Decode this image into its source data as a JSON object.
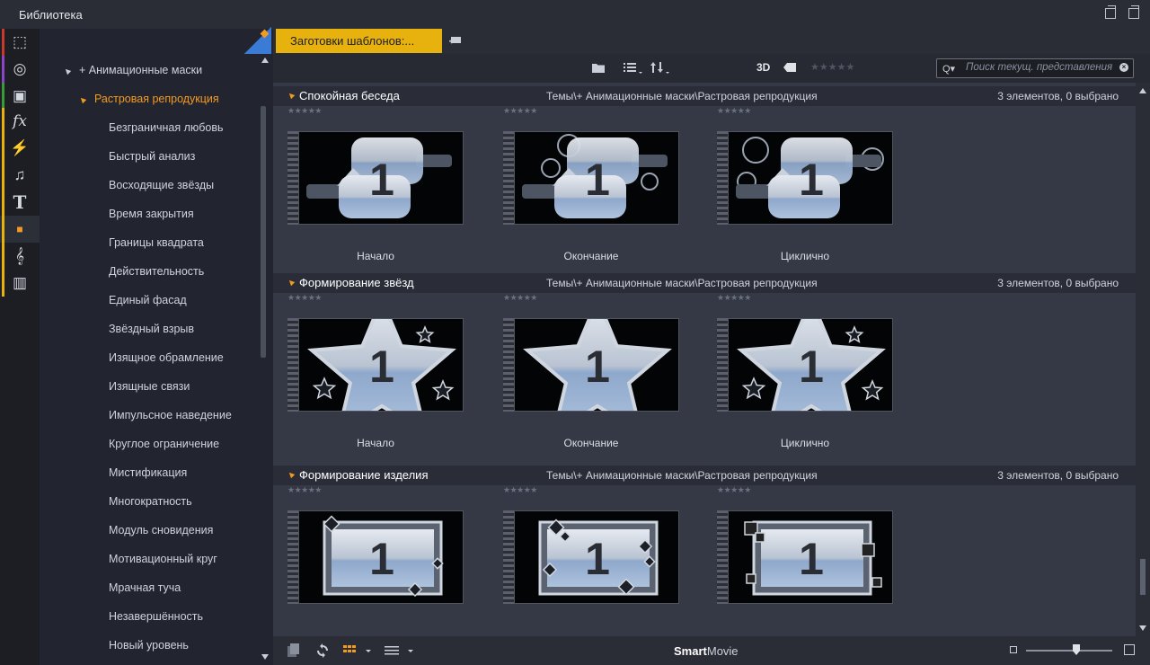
{
  "window": {
    "title": "Библиотека"
  },
  "rail": {
    "items": [
      {
        "name": "projects-icon",
        "glyph": "⬚",
        "color": "#c63a2e"
      },
      {
        "name": "video-reel-icon",
        "glyph": "◎",
        "color": "#8a44c7"
      },
      {
        "name": "photos-icon",
        "glyph": "▣",
        "color": "#3a9a3a"
      },
      {
        "name": "effects-icon",
        "glyph": "fx",
        "color": "#e8b20e"
      },
      {
        "name": "transitions-icon",
        "glyph": "⚡",
        "color": "#e8b20e"
      },
      {
        "name": "music-icon",
        "glyph": "♫",
        "color": "#e8b20e"
      },
      {
        "name": "titles-icon",
        "glyph": "T",
        "color": "#e8b20e"
      },
      {
        "name": "themes-icon",
        "glyph": "■",
        "color": "#e8b20e"
      },
      {
        "name": "scorefitter-icon",
        "glyph": "𝄞",
        "color": "#e8b20e"
      },
      {
        "name": "sound-effects-icon",
        "glyph": "▥",
        "color": "#e8b20e"
      }
    ]
  },
  "tree": {
    "parent": "+ Анимационные маски",
    "selected": "Растровая репродукция",
    "leaves": [
      "Безграничная любовь",
      "Быстрый анализ",
      "Восходящие звёзды",
      "Время закрытия",
      "Границы квадрата",
      "Действительность",
      "Единый фасад",
      "Звёздный взрыв",
      "Изящное обрамление",
      "Изящные связи",
      "Импульсное наведение",
      "Круглое ограничение",
      "Мистификация",
      "Многократность",
      "Модуль сновидения",
      "Мотивационный круг",
      "Мрачная туча",
      "Незавершённость",
      "Новый уровень"
    ]
  },
  "tab": {
    "label": "Заготовки шаблонов:..."
  },
  "toolbar": {
    "view3d": "3D",
    "search_placeholder": "Поиск текущ. представления"
  },
  "groups": [
    {
      "name": "Спокойная беседа",
      "path": "Темы\\+ Анимационные маски\\Растровая репродукция",
      "count": "3 элементов, 0 выбрано",
      "items": [
        "Начало",
        "Окончание",
        "Циклично"
      ],
      "kind": "speech"
    },
    {
      "name": "Формирование звёзд",
      "path": "Темы\\+ Анимационные маски\\Растровая репродукция",
      "count": "3 элементов, 0 выбрано",
      "items": [
        "Начало",
        "Окончание",
        "Циклично"
      ],
      "kind": "star"
    },
    {
      "name": "Формирование изделия",
      "path": "Темы\\+ Анимационные маски\\Растровая репродукция",
      "count": "3 элементов, 0 выбрано",
      "items": [
        "",
        "",
        ""
      ],
      "kind": "frame"
    }
  ],
  "thumb_number": "1",
  "status": {
    "brand_bold": "Smart",
    "brand_rest": "Movie"
  },
  "colors": {
    "accent": "#e8b20e",
    "selected": "#f39a21"
  }
}
